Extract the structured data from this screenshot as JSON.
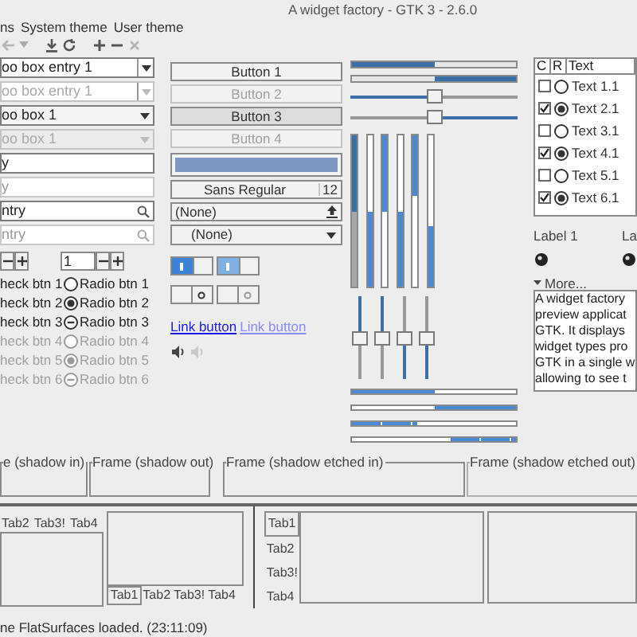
{
  "window": {
    "title": "A widget factory - GTK 3 - 2.6.0"
  },
  "menu": [
    "ns",
    "System theme",
    "User theme"
  ],
  "toolbar": [
    {
      "kind": "back",
      "disabled": true
    },
    {
      "kind": "download",
      "disabled": false
    },
    {
      "kind": "refresh",
      "disabled": false
    },
    {
      "kind": "add",
      "disabled": false
    },
    {
      "kind": "remove",
      "disabled": false
    },
    {
      "kind": "close",
      "disabled": true
    }
  ],
  "combos": [
    {
      "kind": "entry",
      "value": "oo box entry 1",
      "disabled": false
    },
    {
      "kind": "entry",
      "value": "oo box entry 1",
      "disabled": true
    },
    {
      "kind": "combo",
      "value": "oo box 1",
      "disabled": false
    },
    {
      "kind": "combo",
      "value": "oo box 1",
      "disabled": true
    }
  ],
  "entries": [
    {
      "kind": "text",
      "value": "y",
      "disabled": false
    },
    {
      "kind": "text",
      "value": "y",
      "disabled": true
    },
    {
      "kind": "search",
      "value": "ntry",
      "disabled": false
    },
    {
      "kind": "search",
      "value": "ntry",
      "disabled": true
    }
  ],
  "spins": [
    {
      "kind": "buttons"
    },
    {
      "kind": "entry",
      "value": "1"
    }
  ],
  "checks": [
    {
      "label": "heck btn 1",
      "disabled": false
    },
    {
      "label": "heck btn 2",
      "disabled": false
    },
    {
      "label": "heck btn 3",
      "disabled": false
    },
    {
      "label": "heck btn 4",
      "disabled": true
    },
    {
      "label": "heck btn 5",
      "disabled": true
    },
    {
      "label": "heck btn 6",
      "disabled": true
    }
  ],
  "radios": [
    {
      "label": "Radio btn 1",
      "selected": false,
      "inconsistent": false,
      "disabled": false
    },
    {
      "label": "Radio btn 2",
      "selected": true,
      "inconsistent": false,
      "disabled": false
    },
    {
      "label": "Radio btn 3",
      "selected": false,
      "inconsistent": true,
      "disabled": false
    },
    {
      "label": "Radio btn 4",
      "selected": false,
      "inconsistent": false,
      "disabled": true
    },
    {
      "label": "Radio btn 5",
      "selected": true,
      "inconsistent": false,
      "disabled": true
    },
    {
      "label": "Radio btn 6",
      "selected": false,
      "inconsistent": true,
      "disabled": true
    }
  ],
  "buttons": [
    {
      "label": "Button 1",
      "disabled": false,
      "pressed": false
    },
    {
      "label": "Button 2",
      "disabled": true,
      "pressed": false
    },
    {
      "label": "Button 3",
      "disabled": false,
      "pressed": true
    },
    {
      "label": "Button 4",
      "disabled": true,
      "pressed": false
    }
  ],
  "font_button": {
    "family": "Sans Regular",
    "size": "12"
  },
  "file_chooser": {
    "value": "(None)"
  },
  "combo": {
    "value": "(None)"
  },
  "switches": [
    {
      "on": true,
      "disabled": false
    },
    {
      "on": true,
      "disabled": true
    },
    {
      "on": false,
      "disabled": false
    },
    {
      "on": false,
      "disabled": true
    }
  ],
  "links": [
    {
      "label": "Link button",
      "visited": false
    },
    {
      "label": "Link button",
      "visited": true
    }
  ],
  "volume": [
    {
      "disabled": false
    },
    {
      "disabled": true
    }
  ],
  "hscales": [
    {
      "kind": "bar",
      "level": 0.5,
      "inverted": false
    },
    {
      "kind": "bar",
      "level": 0.5,
      "inverted": true
    },
    {
      "kind": "slider",
      "level": 0.5,
      "inverted": false
    },
    {
      "kind": "slider",
      "level": 0.5,
      "inverted": true
    }
  ],
  "vbars": [
    {
      "level": 0.5,
      "inverted": true,
      "dark": true
    },
    {
      "level": 0.5,
      "inverted": false,
      "dark": false
    },
    {
      "level": 0.5,
      "inverted": true,
      "dark": false
    },
    {
      "level": 0.5,
      "inverted": false,
      "dark": false
    },
    {
      "level": 0.4,
      "inverted": true,
      "dark": false
    },
    {
      "level": 0.4,
      "inverted": false,
      "dark": false
    }
  ],
  "vscales": [
    {
      "level": 0.5,
      "inverted": true
    },
    {
      "level": 0.5,
      "inverted": true
    },
    {
      "level": 0.5,
      "inverted": false
    },
    {
      "level": 0.5,
      "inverted": false
    }
  ],
  "progress": [
    {
      "level": 0.5,
      "inverted": false,
      "segmented": false
    },
    {
      "level": 0.5,
      "inverted": true,
      "segmented": false
    },
    {
      "level": 0.4,
      "inverted": false,
      "segmented": true
    },
    {
      "level": 0.4,
      "inverted": true,
      "segmented": true
    }
  ],
  "tree": {
    "columns": [
      "C",
      "R",
      "Text"
    ],
    "rows": [
      {
        "checked": false,
        "radio": false,
        "text": "Text 1.1"
      },
      {
        "checked": true,
        "radio": true,
        "text": "Text 2.1"
      },
      {
        "checked": false,
        "radio": false,
        "text": "Text 3.1"
      },
      {
        "checked": true,
        "radio": true,
        "text": "Text 4.1"
      },
      {
        "checked": false,
        "radio": false,
        "text": "Text 5.1"
      },
      {
        "checked": true,
        "radio": true,
        "text": "Text 6.1"
      }
    ]
  },
  "labels": [
    "Label 1",
    "La"
  ],
  "expander": {
    "label": "More...",
    "expanded": true
  },
  "text_view": {
    "lines": [
      "A widget factory",
      "preview applicat",
      "GTK. It displays",
      "widget types pro",
      "GTK in a single w",
      "allowing to see t"
    ]
  },
  "frames": [
    {
      "label": "e (shadow in)",
      "kind": "in"
    },
    {
      "label": "Frame (shadow out)",
      "kind": "out"
    },
    {
      "label": "Frame (shadow etched in)",
      "kind": "etched_in"
    },
    {
      "label": "Frame (shadow etched out)",
      "kind": "etched_out"
    }
  ],
  "notebooks": [
    {
      "kind": "top",
      "tabs": [
        {
          "label": "Tab2",
          "selected": false
        },
        {
          "label": "Tab3!",
          "selected": false
        },
        {
          "label": "Tab4",
          "selected": false
        }
      ]
    },
    {
      "kind": "bottom",
      "tabs": [
        {
          "label": "Tab1",
          "selected": true
        },
        {
          "label": "Tab2",
          "selected": false
        },
        {
          "label": "Tab3!",
          "selected": false
        },
        {
          "label": "Tab4",
          "selected": false
        }
      ]
    },
    {
      "kind": "left",
      "tabs": [
        {
          "label": "Tab1",
          "selected": true
        },
        {
          "label": "Tab2",
          "selected": false
        },
        {
          "label": "Tab3!",
          "selected": false
        },
        {
          "label": "Tab4",
          "selected": false
        }
      ]
    },
    {
      "kind": "right"
    }
  ],
  "status_bar": "ne FlatSurfaces loaded.  (23:11:09)"
}
